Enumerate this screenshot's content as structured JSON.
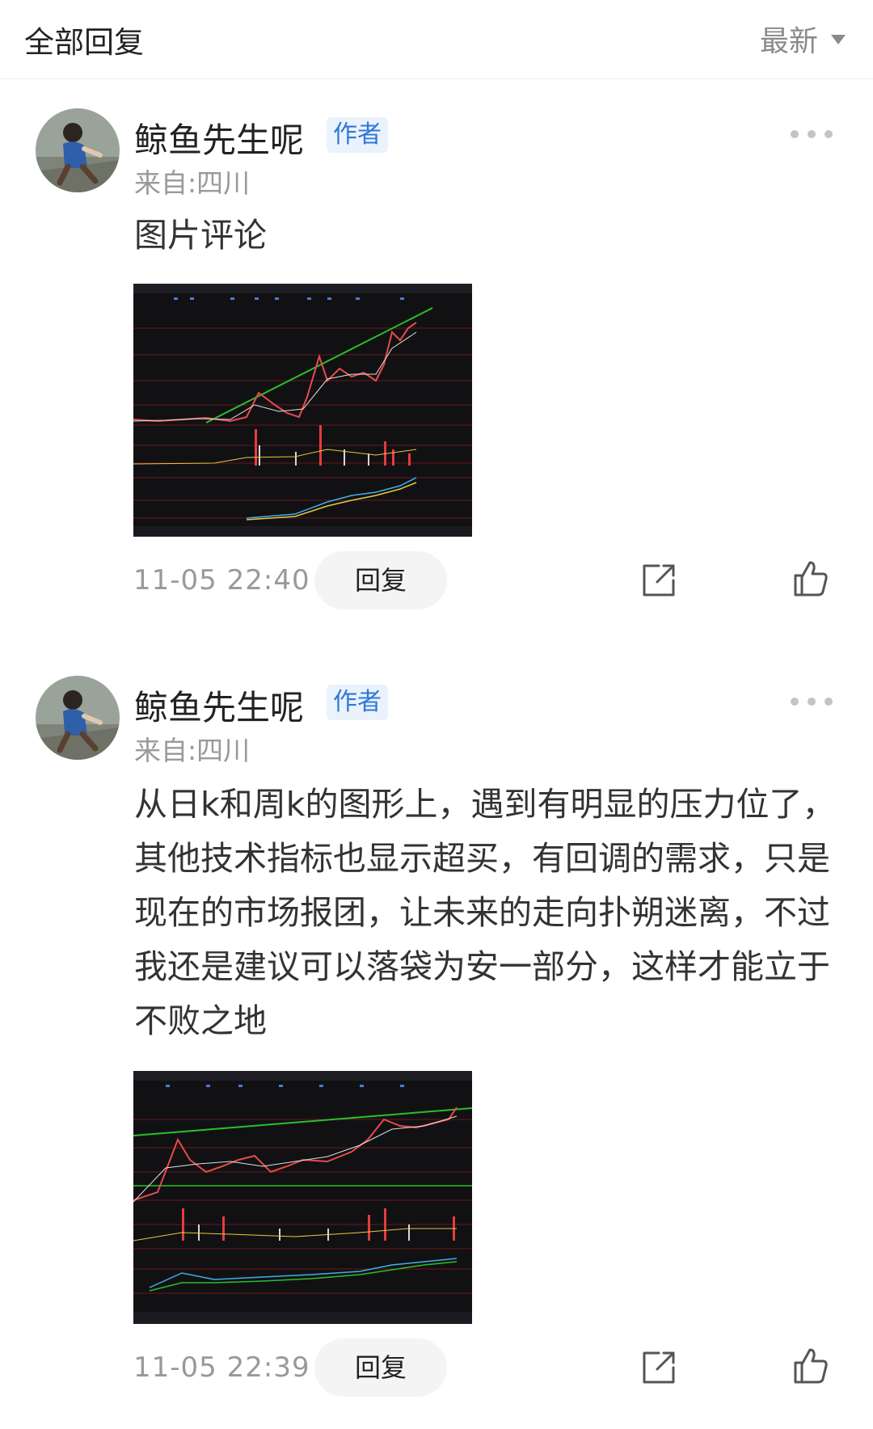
{
  "header": {
    "title": "全部回复",
    "sort_label": "最新"
  },
  "comments": [
    {
      "username": "鲸鱼先生呢",
      "badge": "作者",
      "location": "来自:四川",
      "text": "图片评论",
      "time": "11-05 22:40",
      "reply_label": "回复"
    },
    {
      "username": "鲸鱼先生呢",
      "badge": "作者",
      "location": "来自:四川",
      "text": "从日k和周k的图形上，遇到有明显的压力位了，其他技术指标也显示超买，有回调的需求，只是现在的市场报团，让未来的走向扑朔迷离，不过我还是建议可以落袋为安一部分，这样才能立于不败之地",
      "time": "11-05 22:39",
      "reply_label": "回复"
    }
  ],
  "colors": {
    "badge_bg": "#eaf2fc",
    "badge_text": "#2f78d6",
    "muted": "#999999"
  }
}
